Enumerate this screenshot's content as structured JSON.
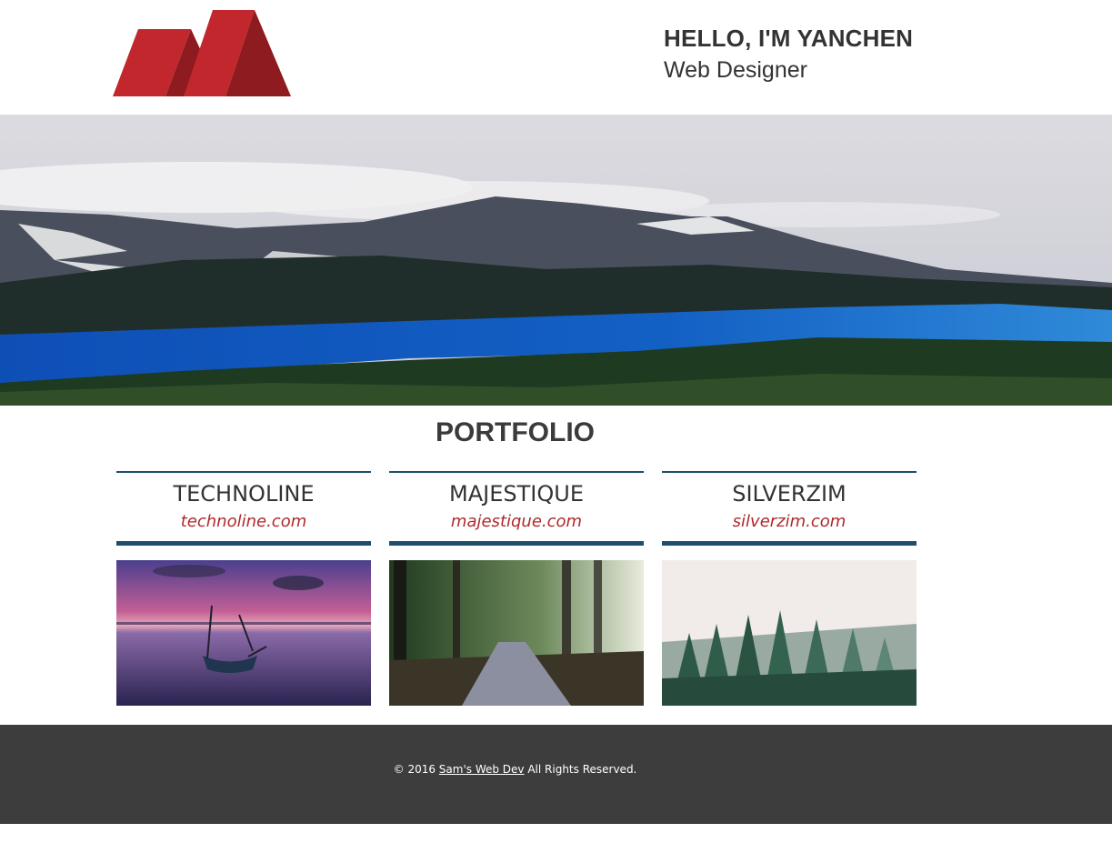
{
  "header": {
    "logo_icon": "mountain-m-logo",
    "greeting": "HELLO, I'M YANCHEN",
    "role": "Web Designer"
  },
  "hero": {
    "image_icon": "mountain-lake-landscape"
  },
  "portfolio": {
    "title": "PORTFOLIO",
    "items": [
      {
        "name": "TECHNOLINE",
        "site": "technoline.com",
        "image_icon": "boat-sunset-lake"
      },
      {
        "name": "MAJESTIQUE",
        "site": "majestique.com",
        "image_icon": "forest-road-sunlight"
      },
      {
        "name": "SILVERZIM",
        "site": "silverzim.com",
        "image_icon": "misty-pine-forest"
      }
    ]
  },
  "footer": {
    "copyright_prefix": "© 2016 ",
    "company": "Sam's Web Dev",
    "copyright_suffix": " All Rights Reserved."
  },
  "colors": {
    "accent_line": "#1d4e6b",
    "link_red": "#b0282b",
    "footer_bg": "#3d3d3d",
    "logo_red": "#c1272d"
  }
}
